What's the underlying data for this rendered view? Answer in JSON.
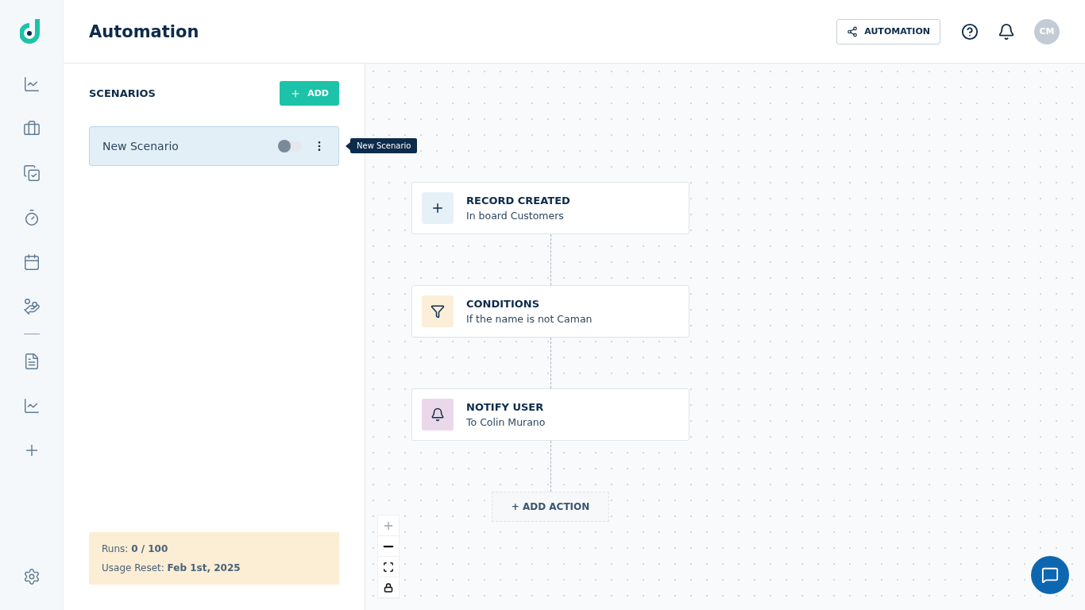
{
  "header": {
    "title": "Automation",
    "automation_button": "AUTOMATION",
    "avatar": "CM"
  },
  "scenarios": {
    "heading": "SCENARIOS",
    "add_button": "ADD",
    "tooltip": "New Scenario",
    "items": [
      {
        "name": "New Scenario",
        "selected": true,
        "on": false
      }
    ]
  },
  "usage": {
    "runs": "Runs: **0 / 100**",
    "reset": "Usage Reset: **Feb 1st, 2025**"
  },
  "flow": {
    "nodes": [
      {
        "kind": "trigger",
        "title": "RECORD CREATED",
        "subtitle": "In board Customers"
      },
      {
        "kind": "condition",
        "title": "CONDITIONS",
        "subtitle": "If the name is not Caman"
      },
      {
        "kind": "notify",
        "title": "NOTIFY USER",
        "subtitle": "To Colin Murano"
      }
    ],
    "add_action": "+ ADD ACTION"
  }
}
